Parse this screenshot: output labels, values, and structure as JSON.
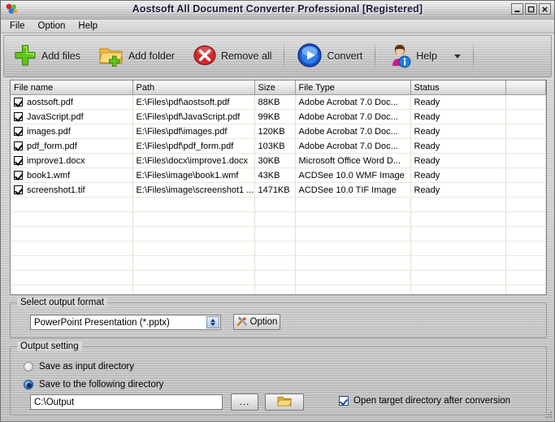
{
  "window": {
    "title": "Aostsoft All Document Converter Professional [Registered]",
    "app_icon": "colored-balls-icon",
    "buttons": {
      "minimize": "_",
      "maximize": "□",
      "close": "✕"
    }
  },
  "menubar": {
    "items": [
      "File",
      "Option",
      "Help"
    ]
  },
  "toolbar": {
    "buttons": [
      {
        "label": "Add files",
        "icon": "green-plus-icon"
      },
      {
        "label": "Add folder",
        "icon": "folder-plus-icon"
      },
      {
        "label": "Remove all",
        "icon": "red-x-circle-icon"
      },
      {
        "label": "Convert",
        "icon": "blue-play-icon"
      },
      {
        "label": "Help",
        "icon": "person-info-icon"
      }
    ],
    "dropdown_caret": "caret-down-icon"
  },
  "filelist": {
    "columns": [
      "File name",
      "Path",
      "Size",
      "File Type",
      "Status",
      ""
    ],
    "rows": [
      {
        "checked": true,
        "name": "aostsoft.pdf",
        "path": "E:\\Files\\pdf\\aostsoft.pdf",
        "size": "88KB",
        "type": "Adobe Acrobat 7.0 Doc...",
        "status": "Ready"
      },
      {
        "checked": true,
        "name": "JavaScript.pdf",
        "path": "E:\\Files\\pdf\\JavaScript.pdf",
        "size": "99KB",
        "type": "Adobe Acrobat 7.0 Doc...",
        "status": "Ready"
      },
      {
        "checked": true,
        "name": "images.pdf",
        "path": "E:\\Files\\pdf\\images.pdf",
        "size": "120KB",
        "type": "Adobe Acrobat 7.0 Doc...",
        "status": "Ready"
      },
      {
        "checked": true,
        "name": "pdf_form.pdf",
        "path": "E:\\Files\\pdf\\pdf_form.pdf",
        "size": "103KB",
        "type": "Adobe Acrobat 7.0 Doc...",
        "status": "Ready"
      },
      {
        "checked": true,
        "name": "improve1.docx",
        "path": "E:\\Files\\docx\\improve1.docx",
        "size": "30KB",
        "type": "Microsoft Office Word D...",
        "status": "Ready"
      },
      {
        "checked": true,
        "name": "book1.wmf",
        "path": "E:\\Files\\image\\book1.wmf",
        "size": "43KB",
        "type": "ACDSee 10.0 WMF Image",
        "status": "Ready"
      },
      {
        "checked": true,
        "name": "screenshot1.tif",
        "path": "E:\\Files\\image\\screenshot1 ...",
        "size": "1471KB",
        "type": "ACDSee 10.0 TIF Image",
        "status": "Ready"
      }
    ],
    "empty_row_count": 8
  },
  "output_format": {
    "legend": "Select output format",
    "selected": "PowerPoint Presentation (*.pptx)",
    "option_button": "Option",
    "option_icon": "tools-icon",
    "spinner_icon": "updown-arrow-icon"
  },
  "output_setting": {
    "legend": "Output setting",
    "radio_input_dir": "Save as input directory",
    "radio_input_dir_selected": false,
    "radio_following_dir": "Save to the following directory",
    "radio_following_dir_selected": true,
    "directory_value": "C:\\Output",
    "browse_dots": "...",
    "browse_folder_icon": "folder-open-icon",
    "open_target_label": "Open target directory after conversion",
    "open_target_checked": true
  },
  "colors": {
    "accent_blue": "#1d4f93",
    "plus_green": "#5cb416",
    "remove_red": "#c02424",
    "folder_yellow": "#f2c13c",
    "title_text": "#1a1a3c"
  }
}
